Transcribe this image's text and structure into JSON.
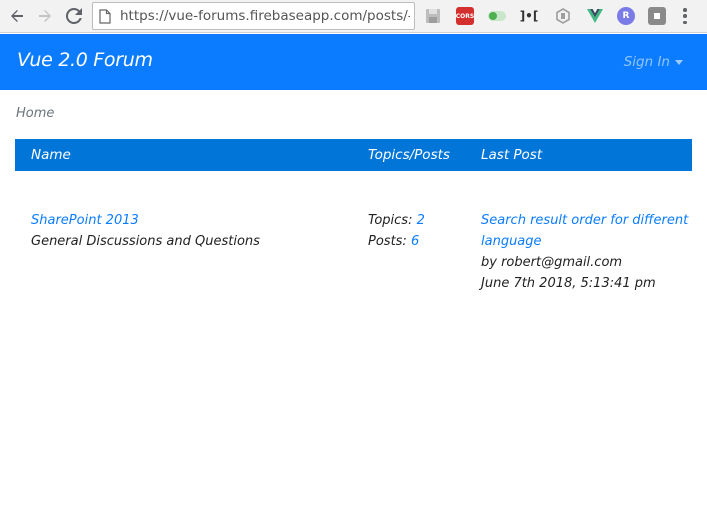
{
  "browser": {
    "url": "https://vue-forums.firebaseapp.com/posts/-L...",
    "extensions": [
      {
        "name": "save-extension",
        "color": "#9e9e9e",
        "label": ""
      },
      {
        "name": "cors-extension",
        "color": "#d32f2f",
        "label": "CORS"
      },
      {
        "name": "toggle-extension",
        "color": "#4caf50",
        "label": ""
      },
      {
        "name": "bracket-extension",
        "color": "#424242",
        "label": "]•["
      },
      {
        "name": "shield-extension",
        "color": "#9e9e9e",
        "label": ""
      },
      {
        "name": "vue-devtools-extension",
        "color": "#41b883",
        "label": ""
      },
      {
        "name": "r-extension",
        "color": "#7b7be8",
        "label": "R"
      },
      {
        "name": "square-extension",
        "color": "#8a8a8a",
        "label": ""
      }
    ]
  },
  "navbar": {
    "brand": "Vue 2.0 Forum",
    "signin": "Sign In",
    "color": "#0b7cff"
  },
  "breadcrumb": {
    "home": "Home"
  },
  "table": {
    "headers": {
      "name": "Name",
      "topics_posts": "Topics/Posts",
      "last_post": "Last Post"
    },
    "header_color": "#0275d8",
    "rows": [
      {
        "forum_name": "SharePoint 2013",
        "description": "General Discussions and Questions",
        "topics_label": "Topics:",
        "topics_count": "2",
        "posts_label": "Posts:",
        "posts_count": "6",
        "last_post_title_line1": "Search result order for different",
        "last_post_title_line2": "language",
        "last_post_by": "by robert@gmail.com",
        "last_post_date": "June 7th 2018, 5:13:41 pm"
      }
    ]
  }
}
